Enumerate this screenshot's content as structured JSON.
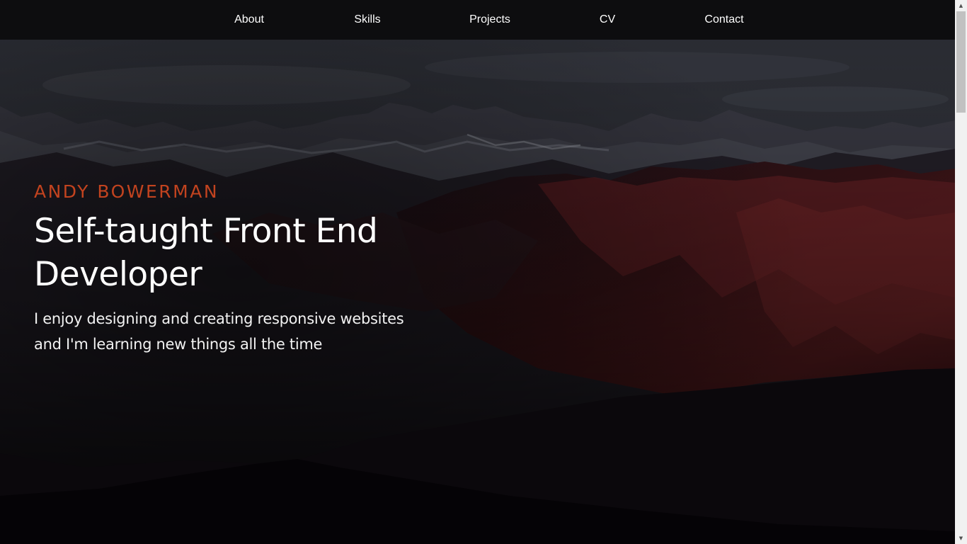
{
  "nav": {
    "items": [
      {
        "label": "About"
      },
      {
        "label": "Skills"
      },
      {
        "label": "Projects"
      },
      {
        "label": "CV"
      },
      {
        "label": "Contact"
      }
    ]
  },
  "hero": {
    "name": "ANDY BOWERMAN",
    "title": "Self-taught Front End Developer",
    "description": "I enjoy designing and creating responsive websites and I'm learning new things all the time"
  },
  "colors": {
    "accent": "#c2431f",
    "nav_background": "#0d0d0f",
    "text": "#ffffff"
  },
  "scrollbar": {
    "position_fraction": 0.0
  }
}
